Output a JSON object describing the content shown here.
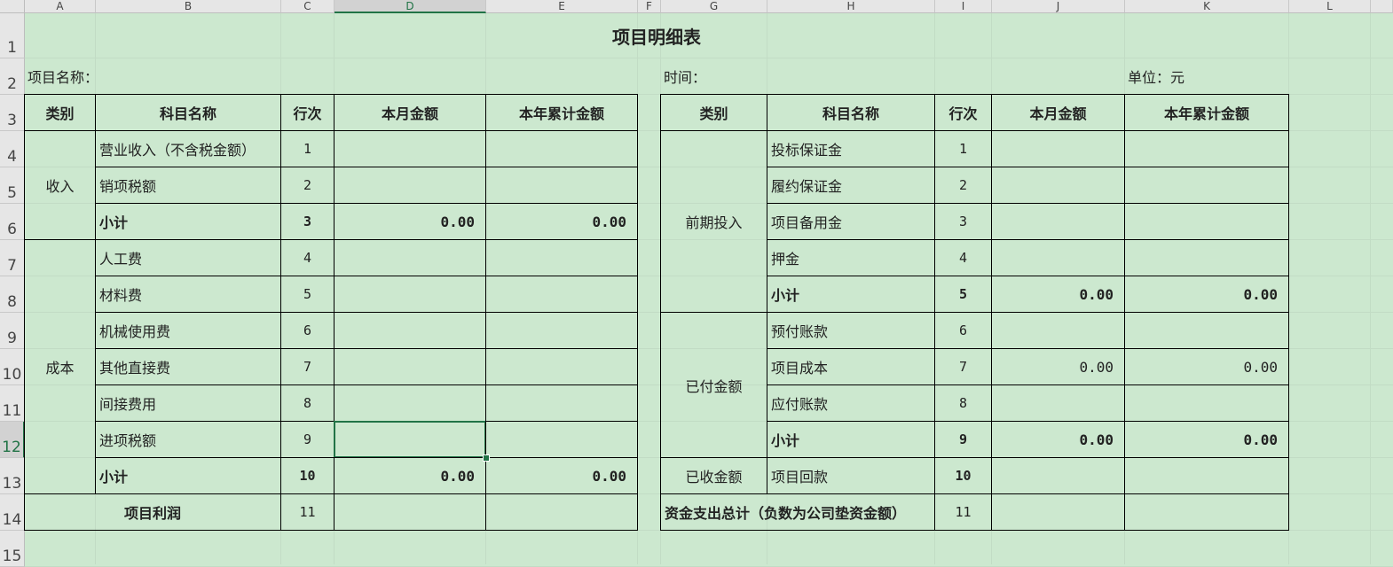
{
  "columns": [
    "A",
    "B",
    "C",
    "D",
    "E",
    "F",
    "G",
    "H",
    "I",
    "J",
    "K",
    "L"
  ],
  "rows": [
    "1",
    "2",
    "3",
    "4",
    "5",
    "6",
    "7",
    "8",
    "9",
    "10",
    "11",
    "12",
    "13",
    "14",
    "15"
  ],
  "selected": {
    "column": "D",
    "row": "12"
  },
  "sheet": {
    "title": "项目明细表",
    "project_name_label": "项目名称：",
    "time_label": "时间：",
    "unit_label": "单位：元",
    "headers": {
      "category": "类别",
      "subject": "科目名称",
      "line": "行次",
      "month_amount": "本月金额",
      "ytd_amount": "本年累计金额"
    },
    "left": {
      "group_income": "收入",
      "group_cost": "成本",
      "rows": [
        {
          "name": "营业收入（不含税金额）",
          "line": "1",
          "month": "",
          "ytd": ""
        },
        {
          "name": "销项税额",
          "line": "2",
          "month": "",
          "ytd": ""
        },
        {
          "name": "小计",
          "line": "3",
          "month": "0.00",
          "ytd": "0.00"
        },
        {
          "name": "人工费",
          "line": "4",
          "month": "",
          "ytd": ""
        },
        {
          "name": "材料费",
          "line": "5",
          "month": "",
          "ytd": ""
        },
        {
          "name": "机械使用费",
          "line": "6",
          "month": "",
          "ytd": ""
        },
        {
          "name": "其他直接费",
          "line": "7",
          "month": "",
          "ytd": ""
        },
        {
          "name": "间接费用",
          "line": "8",
          "month": "",
          "ytd": ""
        },
        {
          "name": "进项税额",
          "line": "9",
          "month": "",
          "ytd": ""
        },
        {
          "name": "小计",
          "line": "10",
          "month": "0.00",
          "ytd": "0.00"
        }
      ],
      "profit_label": "项目利润",
      "profit_line": "11"
    },
    "right": {
      "group_pre": "前期投入",
      "group_paid": "已付金额",
      "group_received": "已收金额",
      "rows": [
        {
          "name": "投标保证金",
          "line": "1",
          "month": "",
          "ytd": ""
        },
        {
          "name": "履约保证金",
          "line": "2",
          "month": "",
          "ytd": ""
        },
        {
          "name": "项目备用金",
          "line": "3",
          "month": "",
          "ytd": ""
        },
        {
          "name": "押金",
          "line": "4",
          "month": "",
          "ytd": ""
        },
        {
          "name": "小计",
          "line": "5",
          "month": "0.00",
          "ytd": "0.00"
        },
        {
          "name": "预付账款",
          "line": "6",
          "month": "",
          "ytd": ""
        },
        {
          "name": "项目成本",
          "line": "7",
          "month": "0.00",
          "ytd": "0.00"
        },
        {
          "name": "应付账款",
          "line": "8",
          "month": "",
          "ytd": ""
        },
        {
          "name": "小计",
          "line": "9",
          "month": "0.00",
          "ytd": "0.00"
        },
        {
          "name": "项目回款",
          "line": "10",
          "month": "",
          "ytd": ""
        }
      ],
      "total_label": "资金支出总计（负数为公司垫资金额）",
      "total_line": "11"
    }
  }
}
